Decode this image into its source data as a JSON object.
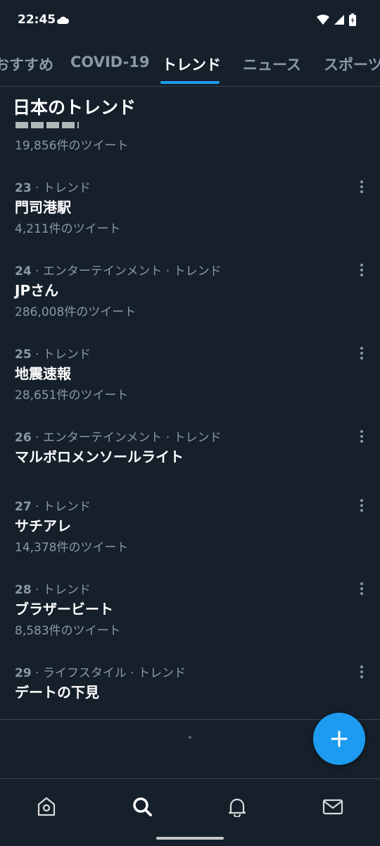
{
  "status": {
    "time": "22:45"
  },
  "tabs": [
    {
      "label": "おすすめ"
    },
    {
      "label": "COVID-19"
    },
    {
      "label": "トレンド"
    },
    {
      "label": "ニュース"
    },
    {
      "label": "スポーツ"
    }
  ],
  "section": {
    "title": "日本のトレンド"
  },
  "cut_item": {
    "count": "19,856件のツイート"
  },
  "trends": [
    {
      "rank": "23",
      "category": "· トレンド",
      "name": "門司港駅",
      "count": "4,211件のツイート"
    },
    {
      "rank": "24",
      "category": "· エンターテインメント · トレンド",
      "name": "JPさん",
      "count": "286,008件のツイート"
    },
    {
      "rank": "25",
      "category": "· トレンド",
      "name": "地震速報",
      "count": "28,651件のツイート"
    },
    {
      "rank": "26",
      "category": "· エンターテインメント · トレンド",
      "name": "マルボロメンソールライト",
      "count": ""
    },
    {
      "rank": "27",
      "category": "· トレンド",
      "name": "サチアレ",
      "count": "14,378件のツイート"
    },
    {
      "rank": "28",
      "category": "· トレンド",
      "name": "ブラザービート",
      "count": "8,583件のツイート"
    },
    {
      "rank": "29",
      "category": "· ライフスタイル · トレンド",
      "name": "デートの下見",
      "count": ""
    }
  ],
  "colors": {
    "accent": "#1d9bf0",
    "background": "#15202b",
    "muted": "#8b98a5"
  },
  "nav": {
    "icons": [
      "home-icon",
      "search-icon",
      "notifications-icon",
      "messages-icon"
    ],
    "active": "search-icon"
  }
}
